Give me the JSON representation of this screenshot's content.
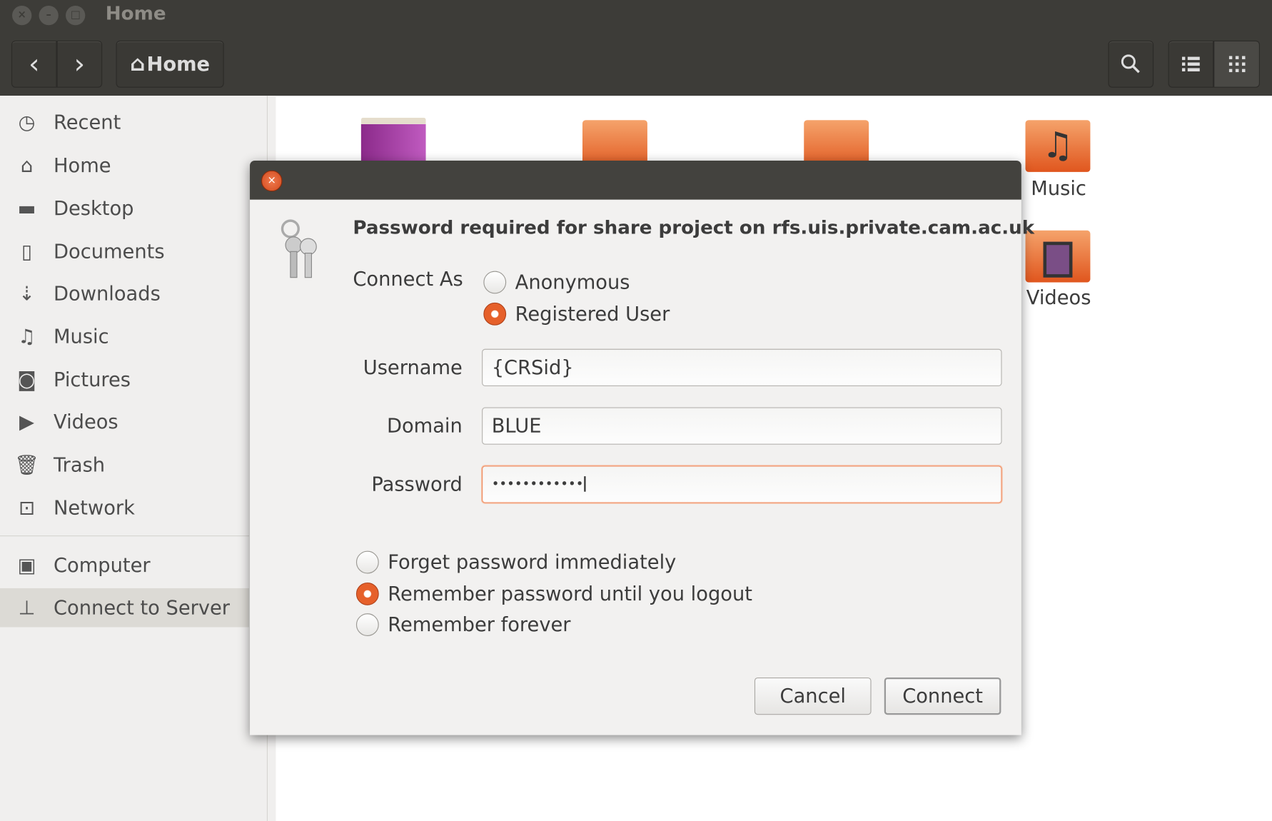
{
  "window": {
    "title": "Home",
    "close": "×",
    "minimize": "–",
    "maximize": "□"
  },
  "toolbar": {
    "back": "‹",
    "forward": "›",
    "location": "Home",
    "location_icon": "home-icon",
    "search_icon": "search-icon",
    "list_view_icon": "list-icon",
    "grid_view_icon": "grid-icon"
  },
  "sidebar": {
    "items": [
      {
        "label": "Recent",
        "icon": "clock-icon",
        "glyph": "◷"
      },
      {
        "label": "Home",
        "icon": "home-icon",
        "glyph": "⌂"
      },
      {
        "label": "Desktop",
        "icon": "folder-icon",
        "glyph": "▬"
      },
      {
        "label": "Documents",
        "icon": "document-icon",
        "glyph": "▯"
      },
      {
        "label": "Downloads",
        "icon": "download-icon",
        "glyph": "⇣"
      },
      {
        "label": "Music",
        "icon": "music-icon",
        "glyph": "♫"
      },
      {
        "label": "Pictures",
        "icon": "camera-icon",
        "glyph": "◙"
      },
      {
        "label": "Videos",
        "icon": "video-icon",
        "glyph": "▶"
      },
      {
        "label": "Trash",
        "icon": "trash-icon",
        "glyph": "🗑"
      },
      {
        "label": "Network",
        "icon": "network-icon",
        "glyph": "⊡"
      },
      {
        "label": "Computer",
        "icon": "computer-icon",
        "glyph": "▣"
      },
      {
        "label": "Connect to Server",
        "icon": "server-icon",
        "glyph": "⊥"
      }
    ]
  },
  "files": [
    {
      "label": "Music"
    },
    {
      "label": "Videos"
    }
  ],
  "dialog": {
    "close": "×",
    "heading": "Password required for share project on rfs.uis.private.cam.ac.uk",
    "connect_as_label": "Connect As",
    "connect_as_options": [
      {
        "label": "Anonymous",
        "selected": false
      },
      {
        "label": "Registered User",
        "selected": true
      }
    ],
    "username_label": "Username",
    "username_value": "{CRSid}",
    "domain_label": "Domain",
    "domain_value": "BLUE",
    "password_label": "Password",
    "password_value": "••••••••••••",
    "remember_options": [
      {
        "label": "Forget password immediately",
        "selected": false
      },
      {
        "label": "Remember password until you logout",
        "selected": true
      },
      {
        "label": "Remember forever",
        "selected": false
      }
    ],
    "cancel": "Cancel",
    "connect": "Connect"
  },
  "colors": {
    "accent": "#e6602a",
    "header": "#3d3c38"
  }
}
